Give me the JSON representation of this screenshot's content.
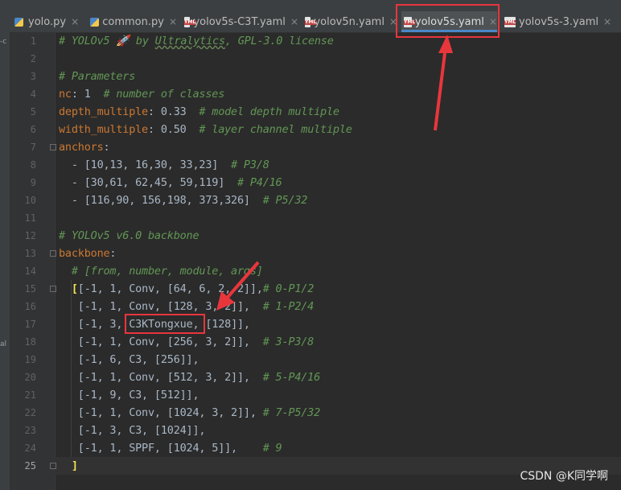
{
  "tabs": [
    {
      "label": "yolo.py",
      "icon": "python-file-icon"
    },
    {
      "label": "common.py",
      "icon": "python-file-icon"
    },
    {
      "label": "yolov5s-C3T.yaml",
      "icon": "yaml-file-icon"
    },
    {
      "label": "yolov5n.yaml",
      "icon": "yaml-file-icon"
    },
    {
      "label": "yolov5s.yaml",
      "icon": "yaml-file-icon",
      "active": true
    },
    {
      "label": "yolov5s-3.yaml",
      "icon": "yaml-file-icon"
    }
  ],
  "close_glyph": "×",
  "left_strip_chars": [
    "-c",
    "al"
  ],
  "line_numbers": [
    "1",
    "2",
    "3",
    "4",
    "5",
    "6",
    "7",
    "8",
    "9",
    "10",
    "11",
    "12",
    "13",
    "14",
    "15",
    "16",
    "17",
    "18",
    "19",
    "20",
    "21",
    "22",
    "23",
    "24",
    "25"
  ],
  "current_line": "25",
  "code": {
    "l1_comment": "# YOLOv5 🚀 by ",
    "l1_ultra": "Ultralytics",
    "l1_rest": ", GPL-3.0 license",
    "l3_comment": "# Parameters",
    "l4_key": "nc",
    "l4_val": ": 1  ",
    "l4_comment": "# number of classes",
    "l5_key": "depth_multiple",
    "l5_val": ": 0.33  ",
    "l5_comment": "# model depth multiple",
    "l6_key": "width_multiple",
    "l6_val": ": 0.50  ",
    "l6_comment": "# layer channel multiple",
    "l7_key": "anchors",
    "l7_val": ":",
    "l8_val": "  - [10,13, 16,30, 33,23]  ",
    "l8_comment": "# P3/8",
    "l9_val": "  - [30,61, 62,45, 59,119]  ",
    "l9_comment": "# P4/16",
    "l10_val": "  - [116,90, 156,198, 373,326]  ",
    "l10_comment": "# P5/32",
    "l12_comment": "# YOLOv5 v6.0 backbone",
    "l13_key": "backbone",
    "l13_val": ":",
    "l14_comment": "  # [from, number, module, args]",
    "l15_pre": "  ",
    "l15_bracket": "[",
    "l15_val": "[-1, 1, Conv, [64, 6, 2, 2]],",
    "l15_comment": "# 0-P1/2",
    "l16_val": "   [-1, 1, Conv, [128, 3, 2]],  ",
    "l16_comment": "# 1-P2/4",
    "l17_pre": "   [-1, 3, ",
    "l17_module": "C3KTongxue,",
    "l17_post": " [128]],",
    "l18_val": "   [-1, 1, Conv, [256, 3, 2]],  ",
    "l18_comment": "# 3-P3/8",
    "l19_val": "   [-1, 6, C3, [256]],",
    "l20_val": "   [-1, 1, Conv, [512, 3, 2]],  ",
    "l20_comment": "# 5-P4/16",
    "l21_val": "   [-1, 9, C3, [512]],",
    "l22_val": "   [-1, 1, Conv, [1024, 3, 2]], ",
    "l22_comment": "# 7-P5/32",
    "l23_val": "   [-1, 3, C3, [1024]],",
    "l24_val": "   [-1, 1, SPPF, [1024, 5]],    ",
    "l24_comment": "# 9",
    "l25_pre": "  ",
    "l25_bracket": "]"
  },
  "watermark": "CSDN @K同学啊",
  "colors": {
    "background": "#2b2b2b",
    "keyword": "#cc7832",
    "comment": "#629755",
    "text": "#a9b7c6",
    "annotation_red": "#e8363d",
    "active_tab_underline": "#4a88c7"
  }
}
